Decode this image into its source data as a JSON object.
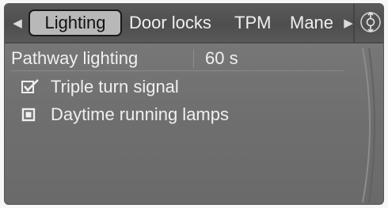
{
  "tabs": {
    "prev_arrow": "◀",
    "next_arrow": "▶",
    "items": [
      {
        "label": "Lighting",
        "active": true
      },
      {
        "label": "Door locks",
        "active": false
      },
      {
        "label": "TPM",
        "active": false
      },
      {
        "label": "Mane",
        "active": false
      }
    ]
  },
  "settings": {
    "pathway_lighting": {
      "label": "Pathway lighting",
      "value": "60 s"
    },
    "triple_turn_signal": {
      "label": "Triple turn signal",
      "checked": true
    },
    "daytime_running_lamps": {
      "label": "Daytime running lamps",
      "checked": false
    }
  },
  "icons": {
    "scroll": "scroll-controller-icon"
  },
  "colors": {
    "panel_bg": "#737373",
    "tab_bar_bg": "#525252",
    "active_tab_bg": "#b8b8b8",
    "text": "#f0f0f0"
  }
}
